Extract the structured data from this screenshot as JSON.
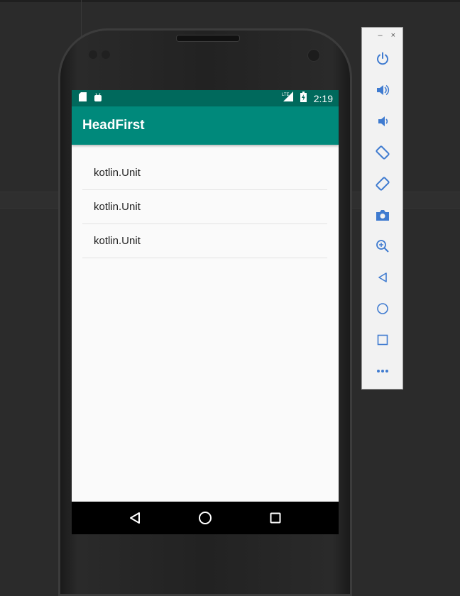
{
  "app": {
    "title": "HeadFirst"
  },
  "status_bar": {
    "time": "2:19",
    "network_label": "LTE"
  },
  "list": {
    "items": [
      {
        "label": "kotlin.Unit"
      },
      {
        "label": "kotlin.Unit"
      },
      {
        "label": "kotlin.Unit"
      }
    ]
  },
  "nav_bar": {
    "icons": [
      "back-icon",
      "home-icon",
      "recents-icon"
    ]
  },
  "emulator_toolbar": {
    "window_controls": {
      "minimize": "–",
      "close": "×"
    },
    "buttons": [
      "power-icon",
      "volume-up-icon",
      "volume-down-icon",
      "rotate-left-icon",
      "rotate-right-icon",
      "camera-icon",
      "zoom-icon",
      "back-icon",
      "home-icon",
      "overview-icon",
      "more-icon"
    ]
  },
  "colors": {
    "app_bar": "#00897b",
    "status_bar": "#00695c",
    "screen_bg": "#fafafa",
    "toolbar_icon": "#3f7bd0"
  }
}
